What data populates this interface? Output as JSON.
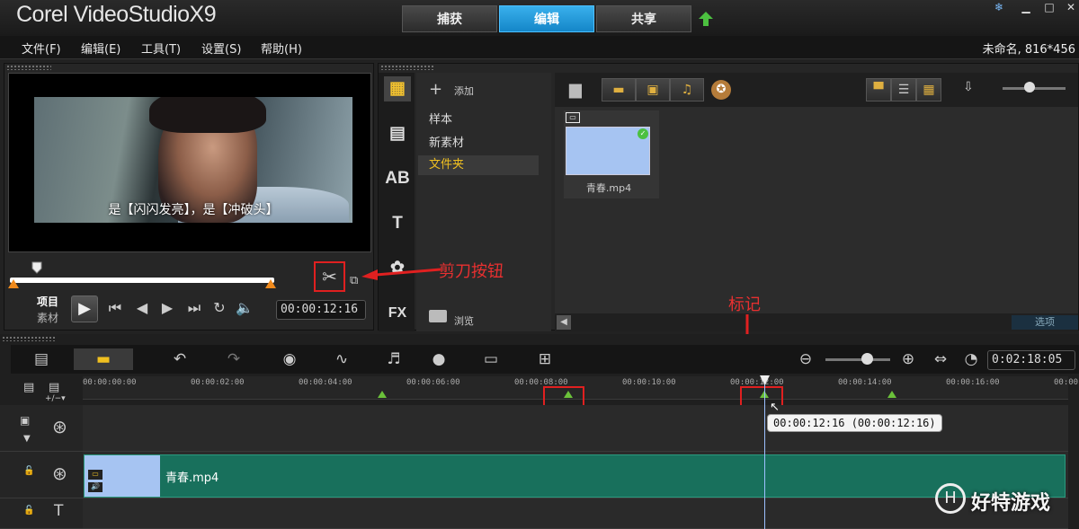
{
  "app": {
    "title": "Corel VideoStudioX9",
    "project_info": "未命名, 816*456"
  },
  "workspace_tabs": [
    "捕获",
    "编辑",
    "共享"
  ],
  "active_tab": "编辑",
  "menu": [
    "文件(F)",
    "编辑(E)",
    "工具(T)",
    "设置(S)",
    "帮助(H)"
  ],
  "player": {
    "subtitle": "是【闪闪发亮】，是【冲破头】",
    "mode_project": "项目",
    "mode_clip": "素材",
    "timecode": "00:00:12:16"
  },
  "library": {
    "add_label": "添加",
    "folders": [
      "样本",
      "新素材",
      "文件夹"
    ],
    "selected_folder": "文件夹",
    "browse_label": "浏览",
    "options_label": "选项",
    "media": [
      {
        "name": "青春.mp4"
      }
    ]
  },
  "annotations": {
    "scissors": "剪刀按钮",
    "marker": "标记"
  },
  "timeline": {
    "project_length": "0:02:18:05",
    "ruler": [
      "00:00:00:00",
      "00:00:02:00",
      "00:00:04:00",
      "00:00:06:00",
      "00:00:08:00",
      "00:00:10:00",
      "00:00:12:00",
      "00:00:14:00",
      "00:00:16:00",
      "00:00:18"
    ],
    "tooltip": "00:00:12:16 (00:00:12:16)",
    "clip_name": "青春.mp4"
  },
  "watermark": "好特游戏",
  "colors": {
    "accent": "#1a96d8",
    "clip": "#18705c",
    "annotation": "#e02020",
    "marker": "#6bc13a"
  }
}
